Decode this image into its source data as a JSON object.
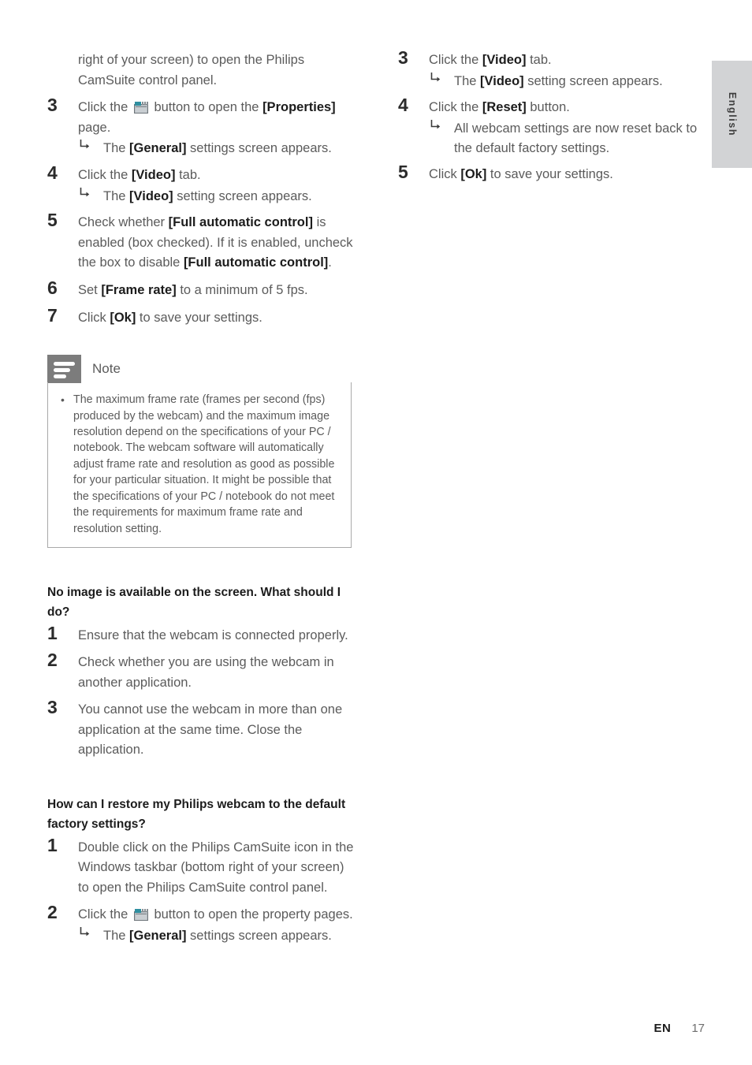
{
  "page": {
    "language_tab": "English",
    "footer": {
      "locale_code": "EN",
      "page_number": "17"
    }
  },
  "left_column": {
    "continued_paragraph": {
      "text": "right of your screen) to open the Philips CamSuite control panel."
    },
    "steps": [
      {
        "number": "3",
        "parts": [
          {
            "type": "text",
            "value": "Click the "
          },
          {
            "type": "icon",
            "value": "webcam-properties-icon"
          },
          {
            "type": "text",
            "value": " button to open the "
          },
          {
            "type": "bold",
            "value": "[Properties]"
          },
          {
            "type": "text",
            "value": " page."
          }
        ],
        "text": "Click the  button to open the [Properties] page.",
        "result": {
          "prefix": "The ",
          "bold": "[General]",
          "suffix": " settings screen appears."
        }
      },
      {
        "number": "4",
        "text": "Click the [Video] tab.",
        "result": {
          "prefix": "The ",
          "bold": "[Video]",
          "suffix": " setting screen appears."
        }
      },
      {
        "number": "5",
        "text": "Check whether [Full automatic control] is enabled (box checked). If it is enabled, uncheck the box to disable [Full automatic control]."
      },
      {
        "number": "6",
        "text": "Set [Frame rate] to a minimum of 5 fps."
      },
      {
        "number": "7",
        "text": "Click [Ok] to save your settings."
      }
    ],
    "note": {
      "title": "Note",
      "bullet": "•",
      "items": [
        "The maximum frame rate (frames per second (fps) produced by the webcam) and the maximum image resolution depend on the specifications of your PC / notebook. The webcam software will automatically adjust frame rate and resolution as good as possible for your particular situation. It might be possible that the specifications of your PC / notebook do not meet the requirements for maximum frame rate and resolution setting."
      ]
    },
    "section_no_image": {
      "heading": "No image is available on the screen. What should I do?",
      "steps": [
        {
          "number": "1",
          "text": "Ensure that the webcam is connected properly."
        },
        {
          "number": "2",
          "text": "Check whether you are using the webcam in another application."
        },
        {
          "number": "3",
          "text": "You cannot use the webcam in more than one application at the same time. Close the application."
        }
      ]
    },
    "section_restore": {
      "heading": "How can I restore my Philips webcam to the default factory settings?",
      "steps": [
        {
          "number": "1",
          "text": "Double click on the Philips CamSuite icon in the Windows taskbar (bottom right of your screen) to open the Philips CamSuite control panel."
        },
        {
          "number": "2",
          "text": "Click the  button to open the property pages.",
          "result": {
            "prefix": "The ",
            "bold": "[General]",
            "suffix": " settings screen appears."
          }
        }
      ]
    }
  },
  "right_column": {
    "steps": [
      {
        "number": "3",
        "text": "Click the [Video] tab.",
        "result": {
          "prefix": "The ",
          "bold": "[Video]",
          "suffix": " setting screen appears."
        }
      },
      {
        "number": "4",
        "text": "Click the [Reset] button.",
        "result": {
          "prefix": "All webcam settings are now reset back to the default factory settings.",
          "bold": "",
          "suffix": ""
        }
      },
      {
        "number": "5",
        "text": "Click [Ok] to save your settings."
      }
    ]
  },
  "colors": {
    "body_text": "#5b5b5b",
    "bold_text": "#1c1c1c",
    "note_badge": "#7c7c7c",
    "lang_tab": "#d2d3d5"
  }
}
